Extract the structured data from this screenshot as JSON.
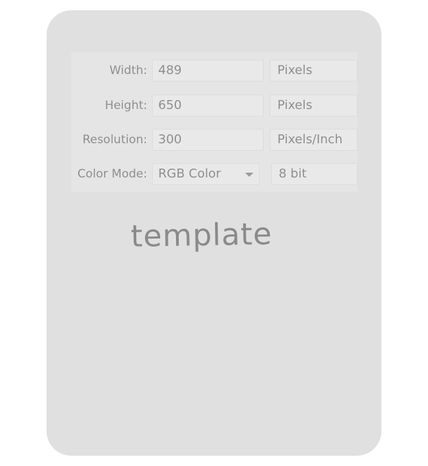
{
  "form": {
    "width": {
      "label": "Width:",
      "value": "489",
      "unit": "Pixels"
    },
    "height": {
      "label": "Height:",
      "value": "650",
      "unit": "Pixels"
    },
    "resolution": {
      "label": "Resolution:",
      "value": "300",
      "unit": "Pixels/Inch"
    },
    "color_mode": {
      "label": "Color Mode:",
      "value": "RGB Color",
      "unit": "8 bit"
    }
  },
  "watermark": "template",
  "colors": {
    "card_background": "#e0e0e0",
    "panel_background": "#e5e5e5",
    "text": "#8f8f8f"
  }
}
